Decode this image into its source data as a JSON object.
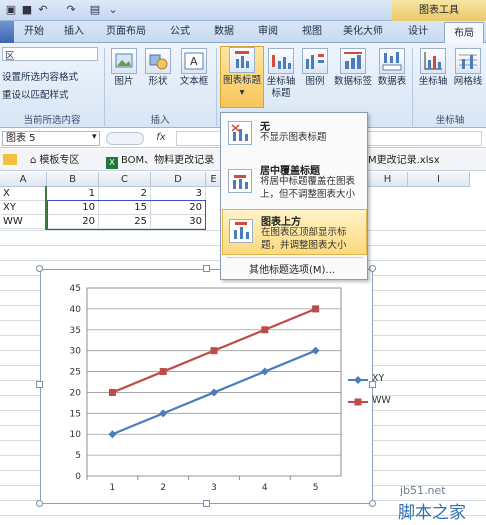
{
  "window": {
    "tools_title": "图表工具"
  },
  "tabs": [
    "开始",
    "插入",
    "页面布局",
    "公式",
    "数据",
    "审阅",
    "视图",
    "美化大师",
    "设计",
    "布局"
  ],
  "ribbon": {
    "current_selection": {
      "name_value": "区",
      "item1": "设置所选内容格式",
      "item2": "重设以匹配样式",
      "label": "当前所选内容"
    },
    "insert": {
      "picture": "图片",
      "shapes": "形状",
      "textbox": "文本框",
      "label": "插入"
    },
    "labels": {
      "chart_title": "图表标题",
      "axis_title": "坐标轴\n标题",
      "legend": "图例",
      "data_labels": "数据标签",
      "data_table": "数据表"
    },
    "axes": {
      "axes": "坐标轴",
      "gridlines": "网格线",
      "label": "坐标轴"
    }
  },
  "formula_bar": {
    "name_box": "图表 5",
    "fx": "fx"
  },
  "file_tabs": [
    {
      "label": "模板专区",
      "icon": "home-icon"
    },
    {
      "label": "BOM、物料更改记录",
      "icon": "excel-icon"
    },
    {
      "label": "M更改记录.xlsx",
      "icon": "excel-icon"
    }
  ],
  "sheet": {
    "columns": [
      "A",
      "B",
      "C",
      "D",
      "E",
      "F",
      "G",
      "H",
      "I"
    ],
    "rows": [
      {
        "a": "X",
        "b": "1",
        "c": "2",
        "d": "3"
      },
      {
        "a": "XY",
        "b": "10",
        "c": "15",
        "d": "20"
      },
      {
        "a": "WW",
        "b": "20",
        "c": "25",
        "d": "30"
      }
    ]
  },
  "menu": {
    "items": [
      {
        "title": "无",
        "desc": "不显示图表标题"
      },
      {
        "title": "居中覆盖标题",
        "desc": "将居中标题覆盖在图表上，但不调整图表大小"
      },
      {
        "title": "图表上方",
        "desc": "在图表区顶部显示标题，并调整图表大小"
      }
    ],
    "more": "其他标题选项(M)..."
  },
  "watermark": {
    "line1": "jb51.net",
    "line2": "脚本之家"
  },
  "chart_data": {
    "type": "line",
    "categories": [
      "1",
      "2",
      "3",
      "4",
      "5"
    ],
    "series": [
      {
        "name": "XY",
        "values": [
          10,
          15,
          20,
          25,
          30
        ],
        "color": "#4a7ebb"
      },
      {
        "name": "WW",
        "values": [
          20,
          25,
          30,
          35,
          40
        ],
        "color": "#be4b48"
      }
    ],
    "ylim": [
      0,
      45
    ],
    "yticks": [
      0,
      5,
      10,
      15,
      20,
      25,
      30,
      35,
      40,
      45
    ],
    "grid": true,
    "legend": "right"
  }
}
